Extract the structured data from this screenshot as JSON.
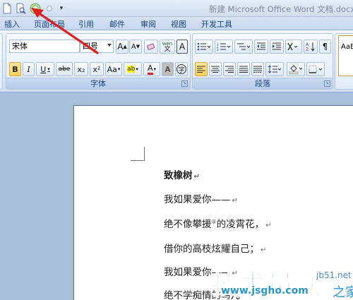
{
  "window": {
    "title": "新建 Microsoft Office Word 文档.docx -"
  },
  "qat": {
    "customize_glyph": "▾"
  },
  "tabs": [
    {
      "label": "插入"
    },
    {
      "label": "页面布局"
    },
    {
      "label": "引用"
    },
    {
      "label": "邮件"
    },
    {
      "label": "审阅"
    },
    {
      "label": "视图"
    },
    {
      "label": "开发工具"
    }
  ],
  "ribbon": {
    "font_group": {
      "label": "字体",
      "font_name": "宋体",
      "font_size": "四号",
      "grow_label": "A",
      "shrink_label": "A",
      "bold_label": "B",
      "italic_label": "I",
      "underline_label": "U",
      "strike_label": "abe",
      "subscript_label": "x₂",
      "superscript_label": "x²",
      "case_label": "Aa",
      "highlight_label": "ab",
      "font_color_label": "A",
      "char_shade_label": "A",
      "enclose_label": "字",
      "phonetic_label": "wén",
      "border_label": "A"
    },
    "paragraph_group": {
      "label": "段落"
    },
    "styles_group": {
      "preview": "AaB"
    }
  },
  "document": {
    "lines": [
      {
        "text": "致橡树",
        "mark": "↵"
      },
      {
        "text": "我如果爱你——",
        "mark": "↵"
      },
      {
        "text": "绝不像攀援",
        "sup": "①",
        "text2": "的凌霄花，",
        "mark": "↵"
      },
      {
        "text": "借你的高枝炫耀自己；",
        "mark": "↵"
      },
      {
        "text": "我如果爱你——",
        "mark": "↵"
      },
      {
        "text": "绝不学痴情的鸟儿",
        "mark": ""
      }
    ]
  },
  "watermark": {
    "main": "技术员联盟",
    "url": "www.jsgho.com",
    "jb51": "jb51.net",
    "home": "之家"
  },
  "colors": {
    "accent": "#15428b",
    "watermark_blue": "#2c94cf",
    "arrow_red": "#e02020"
  }
}
